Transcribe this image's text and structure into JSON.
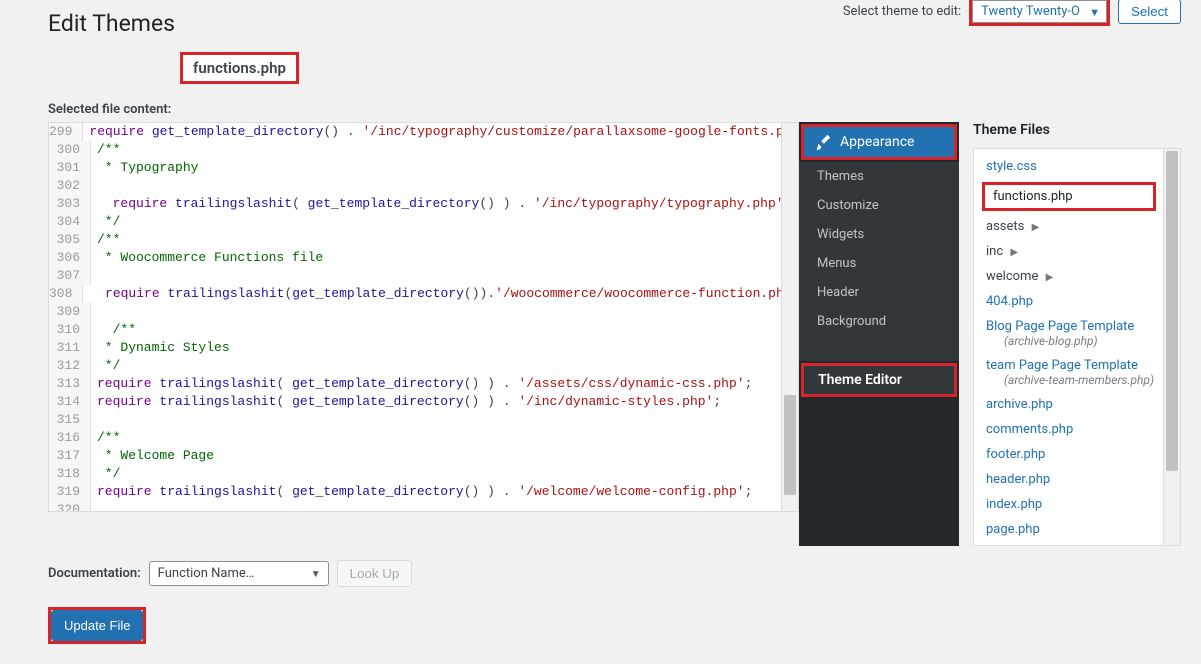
{
  "page": {
    "title": "Edit Themes",
    "current_file_tab": "functions.php",
    "selected_label": "Selected file content:"
  },
  "theme_selector": {
    "label": "Select theme to edit:",
    "value": "Twenty Twenty-O",
    "button": "Select"
  },
  "code": {
    "lines": [
      {
        "n": 299,
        "html": "<span class='c-key'>require</span> <span class='c-fn'>get_template_directory</span>() . <span class='c-str'>'/inc/typography/customize/parallaxsome-google-fonts.php'</span>;"
      },
      {
        "n": 300,
        "html": "<span class='c-cmt'>/**</span>"
      },
      {
        "n": 301,
        "html": "<span class='c-cmt'> * Typography</span>"
      },
      {
        "n": 302,
        "html": ""
      },
      {
        "n": 303,
        "html": "  <span class='c-key'>require</span> <span class='c-fn'>trailingslashit</span>( <span class='c-fn'>get_template_directory</span>() ) . <span class='c-str'>'/inc/typography/typography.php'</span>;"
      },
      {
        "n": 304,
        "html": "<span class='c-cmt'> */</span>"
      },
      {
        "n": 305,
        "html": "<span class='c-cmt'>/**</span>"
      },
      {
        "n": 306,
        "html": "<span class='c-cmt'> * Woocommerce Functions file</span>"
      },
      {
        "n": 307,
        "html": ""
      },
      {
        "n": 308,
        "html": "  <span class='c-key'>require</span> <span class='c-fn'>trailingslashit</span>(<span class='c-fn'>get_template_directory</span>()).<span class='c-str'>'/woocommerce/woocommerce-function.php'</span>;"
      },
      {
        "n": 309,
        "html": ""
      },
      {
        "n": 310,
        "html": "  <span class='c-cmt'>/**</span>"
      },
      {
        "n": 311,
        "html": "<span class='c-cmt'> * Dynamic Styles</span>"
      },
      {
        "n": 312,
        "html": "<span class='c-cmt'> */</span>"
      },
      {
        "n": 313,
        "html": "<span class='c-key'>require</span> <span class='c-fn'>trailingslashit</span>( <span class='c-fn'>get_template_directory</span>() ) . <span class='c-str'>'/assets/css/dynamic-css.php'</span>;"
      },
      {
        "n": 314,
        "html": "<span class='c-key'>require</span> <span class='c-fn'>trailingslashit</span>( <span class='c-fn'>get_template_directory</span>() ) . <span class='c-str'>'/inc/dynamic-styles.php'</span>;"
      },
      {
        "n": 315,
        "html": ""
      },
      {
        "n": 316,
        "html": "<span class='c-cmt'>/**</span>"
      },
      {
        "n": 317,
        "html": "<span class='c-cmt'> * Welcome Page</span>"
      },
      {
        "n": 318,
        "html": "<span class='c-cmt'> */</span>"
      },
      {
        "n": 319,
        "html": "<span class='c-key'>require</span> <span class='c-fn'>trailingslashit</span>( <span class='c-fn'>get_template_directory</span>() ) . <span class='c-str'>'/welcome/welcome-config.php'</span>;"
      },
      {
        "n": 320,
        "html": ""
      }
    ]
  },
  "admin_menu": {
    "head": "Appearance",
    "items": [
      "Themes",
      "Customize",
      "Widgets",
      "Menus",
      "Header",
      "Background"
    ],
    "editor": "Theme Editor"
  },
  "theme_files": {
    "title": "Theme Files",
    "items": [
      {
        "type": "link",
        "label": "style.css"
      },
      {
        "type": "active",
        "label": "functions.php"
      },
      {
        "type": "folder",
        "label": "assets"
      },
      {
        "type": "folder",
        "label": "inc"
      },
      {
        "type": "folder",
        "label": "welcome"
      },
      {
        "type": "link",
        "label": "404.php"
      },
      {
        "type": "link",
        "label": "Blog Page Page Template",
        "sub": "(archive-blog.php)"
      },
      {
        "type": "link",
        "label": "team Page Page Template",
        "sub": "(archive-team-members.php)"
      },
      {
        "type": "link",
        "label": "archive.php"
      },
      {
        "type": "link",
        "label": "comments.php"
      },
      {
        "type": "link",
        "label": "footer.php"
      },
      {
        "type": "link",
        "label": "header.php"
      },
      {
        "type": "link",
        "label": "index.php"
      },
      {
        "type": "link",
        "label": "page.php"
      }
    ]
  },
  "documentation": {
    "label": "Documentation:",
    "value": "Function Name…",
    "lookup": "Look Up"
  },
  "update_button": "Update File"
}
